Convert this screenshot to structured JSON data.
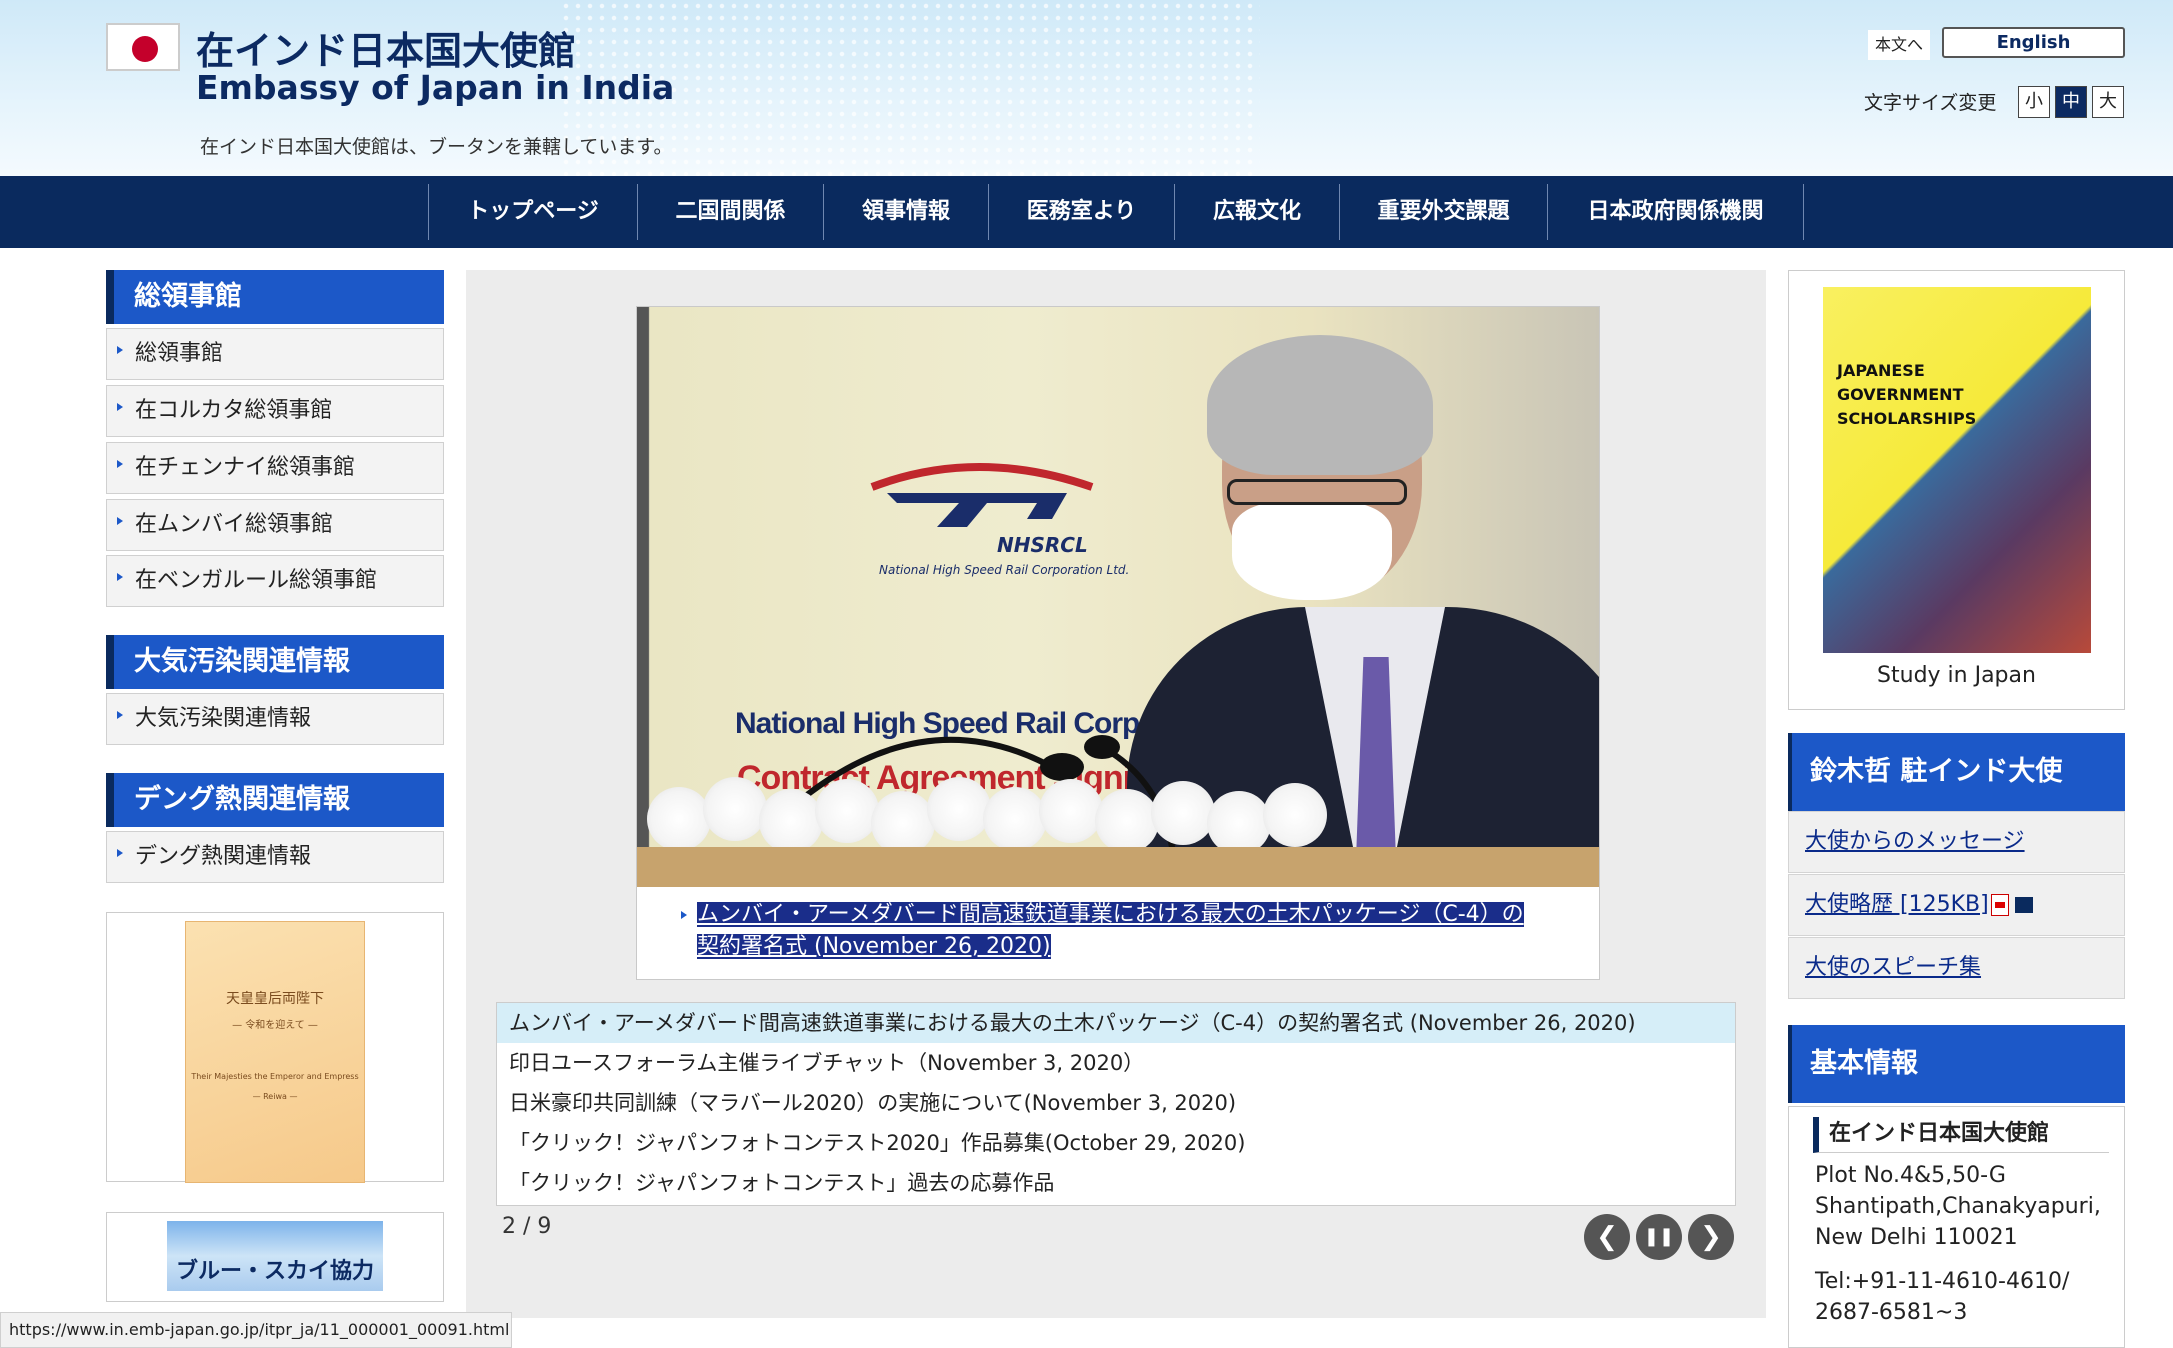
{
  "header": {
    "title_ja": "在インド日本国大使館",
    "title_en": "Embassy of Japan in India",
    "note": "在インド日本国大使館は、ブータンを兼轄しています。",
    "skip_link": "本文へ",
    "english_button": "English",
    "fontsize_label": "文字サイズ変更",
    "fontsize_options": [
      "小",
      "中",
      "大"
    ]
  },
  "nav": {
    "items": [
      "トップページ",
      "二国間関係",
      "領事情報",
      "医務室より",
      "広報文化",
      "重要外交課題",
      "日本政府関係機関"
    ]
  },
  "left_sidebar": {
    "consulates": {
      "heading": "総領事館",
      "items": [
        "総領事館",
        "在コルカタ総領事館",
        "在チェンナイ総領事館",
        "在ムンバイ総領事館",
        "在ベンガルール総領事館"
      ]
    },
    "air_pollution": {
      "heading": "大気汚染関連情報",
      "items": [
        "大気汚染関連情報"
      ]
    },
    "dengue": {
      "heading": "デング熱関連情報",
      "items": [
        "デング熱関連情報"
      ]
    },
    "emperor_banner": {
      "title": "天皇皇后両陛下",
      "subtitle": "— 令和を迎えて —",
      "en_line1": "Their Majesties the Emperor and Empress",
      "en_line2": "— Reiwa —"
    },
    "bluesky_banner": "ブルー・スカイ協力"
  },
  "slideshow": {
    "photo": {
      "logo_text": "NHSRCL",
      "logo_sub": "National High Speed Rail Corporation Ltd.",
      "banner_line1": "National High Speed Rail Corporation",
      "banner_line2": "Contract Agreement Signing"
    },
    "caption": "ムンバイ・アーメダバード間高速鉄道事業における最大の土木パッケージ（C-4）の契約署名式 (November 26, 2020)",
    "news": [
      "ムンバイ・アーメダバード間高速鉄道事業における最大の土木パッケージ（C-4）の契約署名式 (November 26, 2020)",
      "印日ユースフォーラム主催ライブチャット（November 3, 2020）",
      "日米豪印共同訓練（マラバール2020）の実施について(November 3, 2020)",
      "「クリック！ジャパンフォトコンテスト2020」作品募集(October 29, 2020)",
      "「クリック！ジャパンフォトコンテスト」過去の応募作品"
    ],
    "pager": "2 / 9",
    "controls": {
      "prev": "❮",
      "pause": "❚❚",
      "next": "❯"
    }
  },
  "right_sidebar": {
    "study": {
      "poster_lines": [
        "JAPANESE",
        "GOVERNMENT",
        "SCHOLARSHIPS"
      ],
      "caption": "Study in Japan"
    },
    "ambassador": {
      "heading": "鈴木哲 駐インド大使",
      "links": [
        "大使からのメッセージ",
        "大使略歴 [125KB]",
        "大使のスピーチ集"
      ]
    },
    "basic_info": {
      "heading": "基本情報",
      "title": "在インド日本国大使館",
      "address": [
        "Plot No.4&5,50-G",
        "Shantipath,Chanakyapuri,",
        "New Delhi 110021"
      ],
      "tel": [
        "Tel:+91-11-4610-4610/",
        "2687-6581~3"
      ]
    }
  },
  "status_bar": "https://www.in.emb-japan.go.jp/itpr_ja/11_000001_00091.html",
  "colors": {
    "navy": "#0a2a5e",
    "heading_blue": "#1c58c8",
    "flag_red": "#c4002b",
    "highlight": "#d6eef8"
  }
}
